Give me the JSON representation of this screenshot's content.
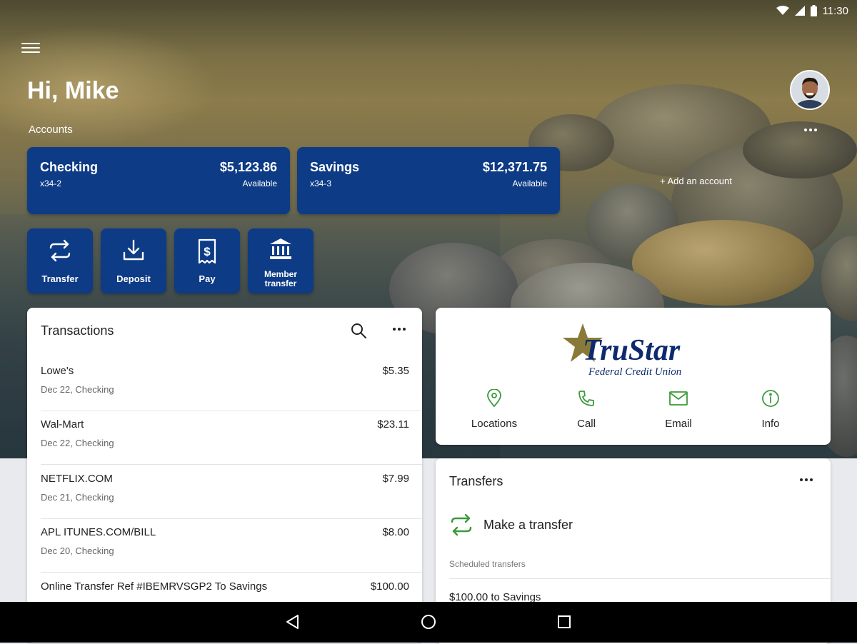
{
  "status_bar": {
    "time": "11:30"
  },
  "header": {
    "greeting": "Hi, Mike",
    "accounts_label": "Accounts",
    "add_account": "+ Add an account"
  },
  "accounts": [
    {
      "name": "Checking",
      "number": "x34-2",
      "balance": "$5,123.86",
      "balance_label": "Available"
    },
    {
      "name": "Savings",
      "number": "x34-3",
      "balance": "$12,371.75",
      "balance_label": "Available"
    }
  ],
  "quick_actions": [
    {
      "label": "Transfer",
      "icon": "transfer-icon"
    },
    {
      "label": "Deposit",
      "icon": "deposit-icon"
    },
    {
      "label": "Pay",
      "icon": "pay-bill-icon"
    },
    {
      "label": "Member transfer",
      "icon": "bank-icon"
    }
  ],
  "transactions": {
    "title": "Transactions",
    "items": [
      {
        "name": "Lowe's",
        "detail": "Dec 22, Checking",
        "amount": "$5.35"
      },
      {
        "name": "Wal-Mart",
        "detail": "Dec 22, Checking",
        "amount": "$23.11"
      },
      {
        "name": "NETFLIX.COM",
        "detail": "Dec 21, Checking",
        "amount": "$7.99"
      },
      {
        "name": "APL ITUNES.COM/BILL",
        "detail": "Dec 20, Checking",
        "amount": "$8.00"
      },
      {
        "name": "Online Transfer Ref #IBEMRVSGP2 To Savings",
        "detail": "",
        "amount": "$100.00"
      }
    ]
  },
  "credit_union": {
    "logo_name": "TruStar",
    "logo_tagline": "Federal Credit Union",
    "actions": [
      {
        "label": "Locations",
        "icon": "location-pin-icon"
      },
      {
        "label": "Call",
        "icon": "phone-icon"
      },
      {
        "label": "Email",
        "icon": "email-icon"
      },
      {
        "label": "Info",
        "icon": "info-icon"
      }
    ]
  },
  "transfers": {
    "title": "Transfers",
    "make_transfer": "Make a transfer",
    "scheduled_label": "Scheduled transfers",
    "scheduled": [
      "$100.00 to Savings"
    ]
  },
  "colors": {
    "brand_blue": "#0d3b85",
    "accent_green": "#3a9a3a",
    "logo_gold": "#8a7a3a"
  }
}
